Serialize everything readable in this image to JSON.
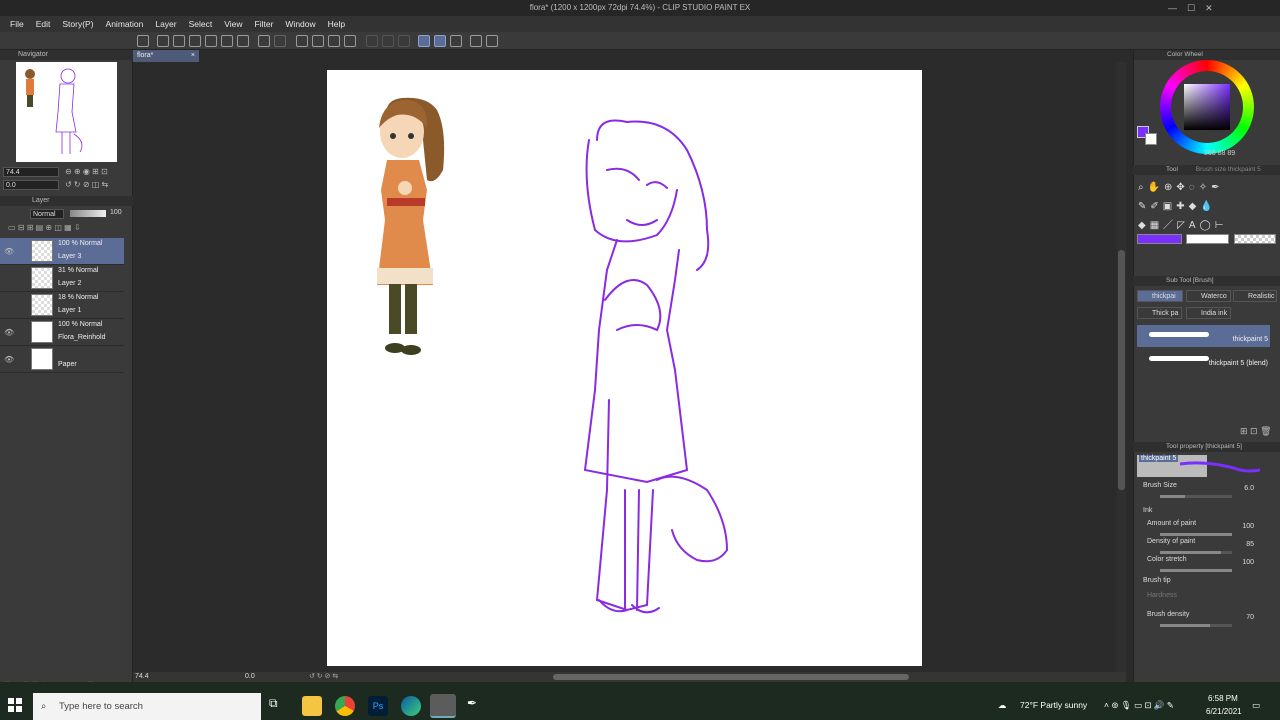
{
  "window": {
    "title": "flora* (1200 x 1200px 72dpi 74.4%) - CLIP STUDIO PAINT EX"
  },
  "menu": [
    "File",
    "Edit",
    "Story(P)",
    "Animation",
    "Layer",
    "Select",
    "View",
    "Filter",
    "Window",
    "Help"
  ],
  "navigator": {
    "title": "Navigator",
    "zoom": "74.4",
    "rotation": "0.0"
  },
  "layer_panel": {
    "title": "Layer",
    "blend_mode": "Normal",
    "opacity": "100",
    "layers": [
      {
        "mode": "100 % Normal",
        "name": "Layer 3",
        "visible": true,
        "selected": true
      },
      {
        "mode": "31 % Normal",
        "name": "Layer 2",
        "visible": false,
        "selected": false
      },
      {
        "mode": "18 % Normal",
        "name": "Layer 1",
        "visible": false,
        "selected": false
      },
      {
        "mode": "100 % Normal",
        "name": "Flora_Reinhold",
        "visible": true,
        "selected": false
      },
      {
        "mode": "",
        "name": "Paper",
        "visible": true,
        "selected": false
      }
    ]
  },
  "document": {
    "tab": "flora*",
    "zoom": "74.4",
    "angle": "0.0"
  },
  "color_wheel": {
    "title": "Color Wheel",
    "main_color": "#7a2fff",
    "sub_color": "#ffffff",
    "hsv": [
      "268",
      "88",
      "89"
    ]
  },
  "tool_panel": {
    "title": "Tool",
    "active_tool": "Brush size thickpaint 5"
  },
  "sub_tool": {
    "title": "Sub Tool [Brush]",
    "tabs": [
      "thickpai",
      "Waterco",
      "Realistic",
      "Thick pa",
      "India ink"
    ],
    "brushes": [
      {
        "name": "thickpaint 5",
        "selected": true
      },
      {
        "name": "thickpaint 5 (blend)",
        "selected": false
      }
    ]
  },
  "tool_property": {
    "title": "Tool property [thickpaint 5]",
    "preset": "thickpaint 5",
    "brush_size_label": "Brush Size",
    "brush_size": "6.0",
    "ink_label": "Ink",
    "amount_label": "Amount of paint",
    "amount": "100",
    "density_label": "Density of paint",
    "density": "85",
    "stretch_label": "Color stretch",
    "stretch": "100",
    "tip_label": "Brush tip",
    "hardness_label": "Hardness",
    "brush_density_label": "Brush density",
    "brush_density": "70"
  },
  "taskbar": {
    "search_placeholder": "Type here to search",
    "weather": "72°F  Partly sunny",
    "time": "6:58 PM",
    "date": "6/21/2021"
  },
  "colors": {
    "accent": "#5b6d96",
    "sketch": "#8a2be2"
  }
}
